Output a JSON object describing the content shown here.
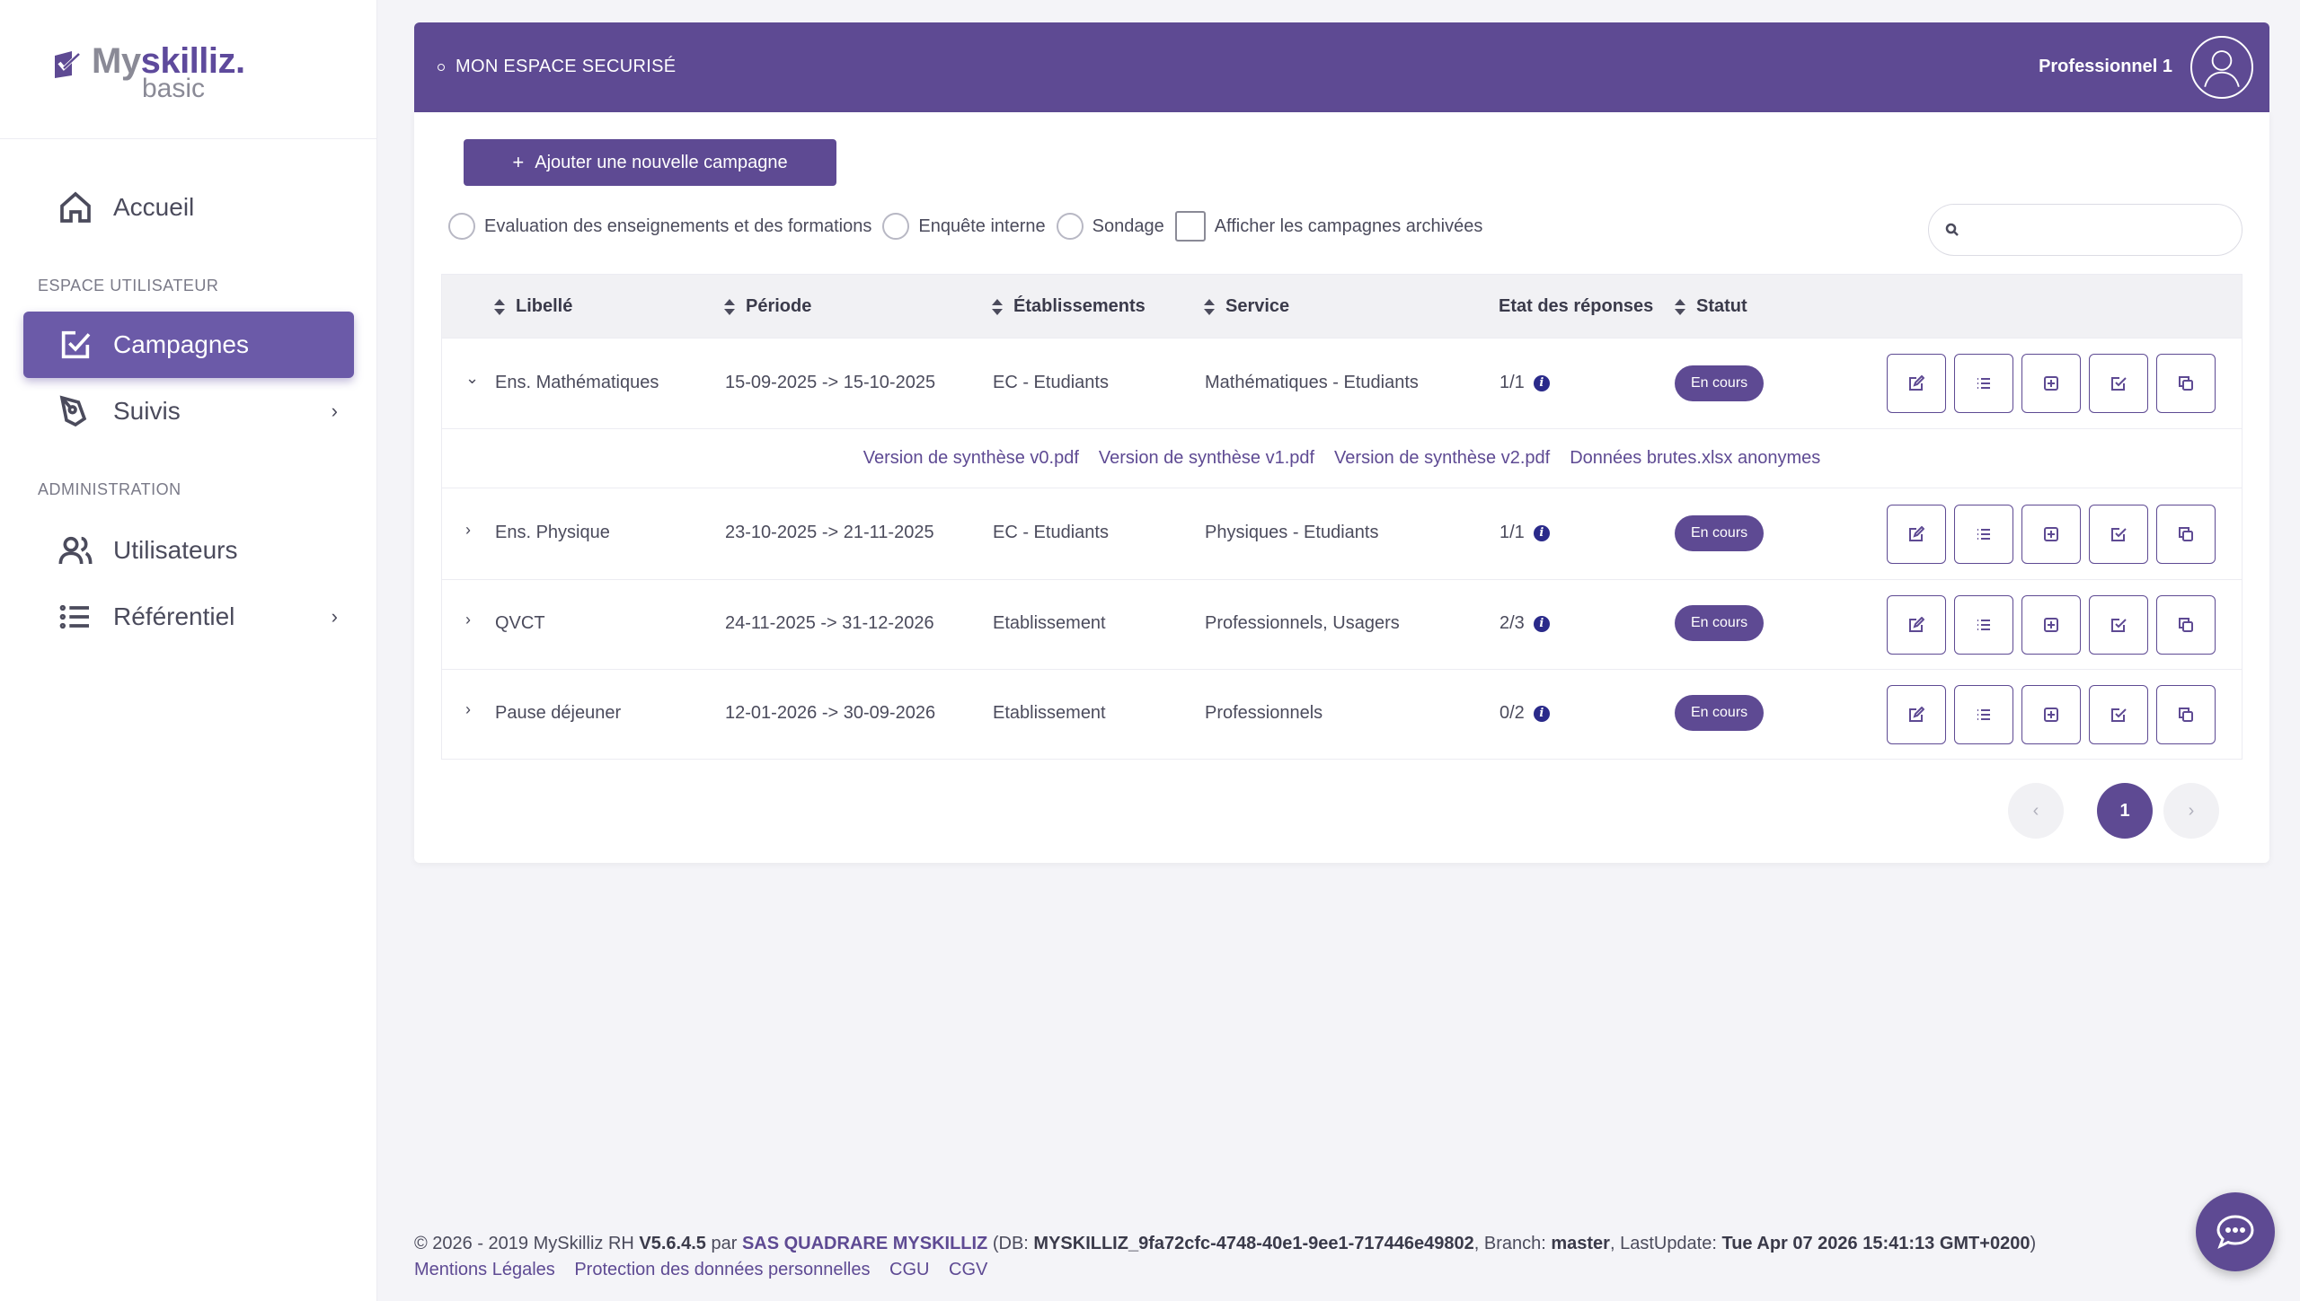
{
  "app": {
    "logo_main": "Myskilliz.",
    "logo_sub": "basic"
  },
  "sidebar": {
    "home": "Accueil",
    "section_user": "ESPACE UTILISATEUR",
    "campaigns": "Campagnes",
    "follow": "Suivis",
    "section_admin": "ADMINISTRATION",
    "users": "Utilisateurs",
    "referential": "Référentiel"
  },
  "header": {
    "breadcrumb": "MON ESPACE SECURISÉ",
    "user": "Professionnel 1"
  },
  "toolbar": {
    "add_label": "Ajouter une nouvelle campagne",
    "filters": [
      "Evaluation des enseignements et des formations",
      "Enquête interne",
      "Sondage"
    ],
    "archived_label": "Afficher les campagnes archivées",
    "search_value": ""
  },
  "table": {
    "columns": [
      "Libellé",
      "Période",
      "Établissements",
      "Service",
      "Etat des réponses",
      "Statut"
    ],
    "rows": [
      {
        "label": "Ens. Mathématiques",
        "period": "15-09-2025 -> 15-10-2025",
        "establishment": "EC - Etudiants",
        "service": "Mathématiques - Etudiants",
        "responses": "1/1",
        "status": "En cours",
        "expanded": true
      },
      {
        "label": "Ens. Physique",
        "period": "23-10-2025 -> 21-11-2025",
        "establishment": "EC - Etudiants",
        "service": "Physiques - Etudiants",
        "responses": "1/1",
        "status": "En cours",
        "expanded": false
      },
      {
        "label": "QVCT",
        "period": "24-11-2025 -> 31-12-2026",
        "establishment": "Etablissement",
        "service": "Professionnels, Usagers",
        "responses": "2/3",
        "status": "En cours",
        "expanded": false
      },
      {
        "label": "Pause déjeuner",
        "period": "12-01-2026 -> 30-09-2026",
        "establishment": "Etablissement",
        "service": "Professionnels",
        "responses": "0/2",
        "status": "En cours",
        "expanded": false
      }
    ],
    "files": [
      "Version de synthèse v0.pdf",
      "Version de synthèse v1.pdf",
      "Version de synthèse v2.pdf",
      "Données brutes.xlsx anonymes"
    ]
  },
  "pagination": {
    "prev": "‹",
    "current": "1",
    "next": "›"
  },
  "footer": {
    "copyright": "© 2026 - 2019 MySkilliz RH ",
    "version": "V5.6.4.5",
    "par": " par ",
    "company": "SAS QUADRARE MYSKILLIZ",
    "db_prefix": " (DB: ",
    "db": "MYSKILLIZ_9fa72cfc-4748-40e1-9ee1-717446e49802",
    "branch_prefix": ", Branch: ",
    "branch": "master",
    "update_prefix": ", LastUpdate: ",
    "update": "Tue Apr 07 2026 15:41:13 GMT+0200",
    "close": ")",
    "links": [
      "Mentions Légales",
      "Protection des données personnelles",
      "CGU",
      "CGV"
    ]
  },
  "colors": {
    "accent": "#5e4a93",
    "active_nav": "#6b5aa8",
    "info_icon": "#2a2a8a"
  }
}
